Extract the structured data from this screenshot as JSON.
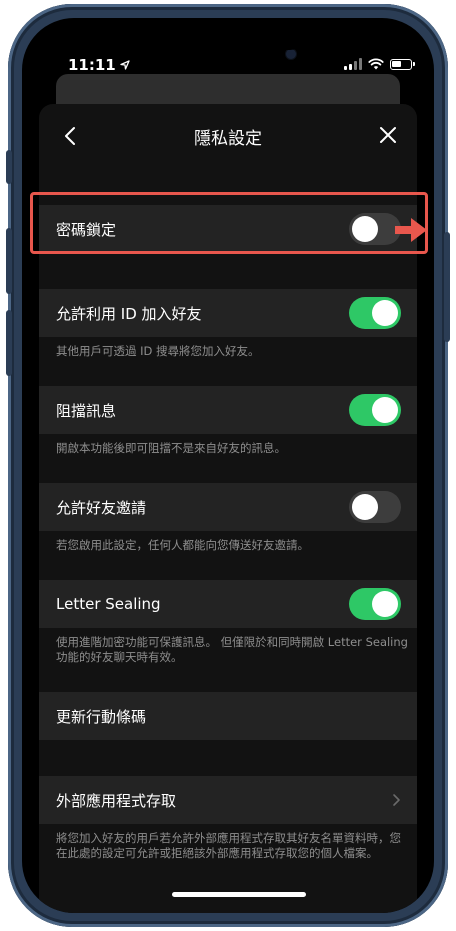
{
  "status": {
    "time": "11:11"
  },
  "header": {
    "title": "隱私設定"
  },
  "rows": {
    "passcode": {
      "label": "密碼鎖定"
    },
    "allow_id": {
      "label": "允許利用 ID 加入好友",
      "desc": "其他用戶可透過 ID 搜尋將您加入好友。"
    },
    "block": {
      "label": "阻擋訊息",
      "desc": "開啟本功能後即可阻擋不是來自好友的訊息。"
    },
    "invites": {
      "label": "允許好友邀請",
      "desc": "若您啟用此設定，任何人都能向您傳送好友邀請。"
    },
    "letter": {
      "label": "Letter Sealing",
      "desc": "使用進階加密功能可保護訊息。 但僅限於和同時開啟 Letter Sealing 功能的好友聊天時有效。"
    },
    "update_code": {
      "label": "更新行動條碼"
    },
    "external": {
      "label": "外部應用程式存取",
      "desc": "將您加入好友的用戶若允許外部應用程式存取其好友名單資料時，您在此處的設定可允許或拒絕該外部應用程式存取您的個人檔案。"
    }
  },
  "toggles": {
    "passcode": false,
    "allow_id": true,
    "block": true,
    "invites": false,
    "letter": true
  },
  "colors": {
    "toggle_on": "#2ec866",
    "highlight": "#e8574d",
    "background": "#121212"
  },
  "icons": [
    "location-arrow-icon",
    "signal-icon",
    "wifi-icon",
    "battery-icon",
    "back-chevron-icon",
    "close-icon",
    "chevron-right-icon",
    "annotation-arrow-icon"
  ]
}
